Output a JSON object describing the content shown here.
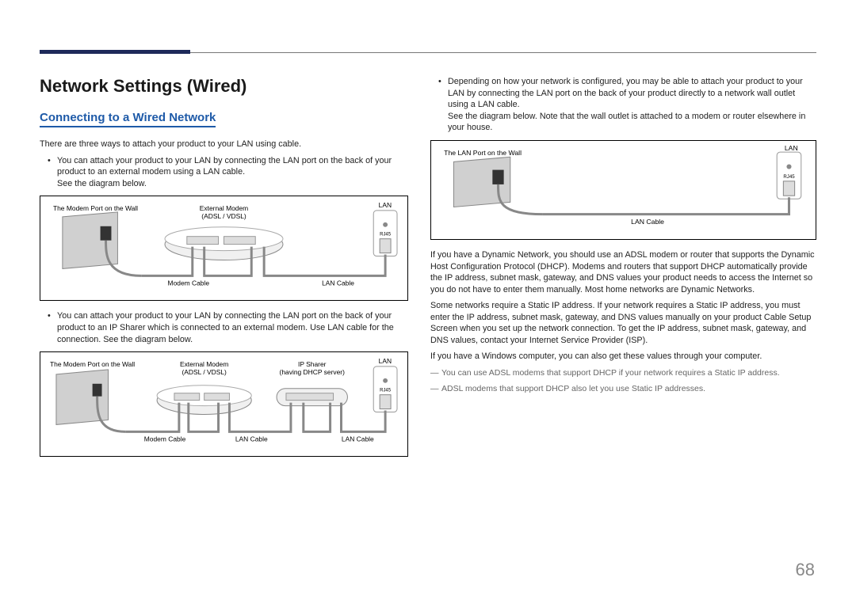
{
  "page_number": "68",
  "title": "Network Settings (Wired)",
  "subtitle": "Connecting to a Wired Network",
  "intro": "There are three ways to attach your product to your LAN using cable.",
  "left_bullet1": "You can attach your product to your LAN by connecting the LAN port on the back of your product to an external modem using a LAN cable.",
  "see_below": "See the diagram below.",
  "left_bullet2": "You can attach your product to your LAN by connecting the LAN port on the back of your product to an IP Sharer which is connected to an external modem. Use LAN cable for the connection. See the diagram below.",
  "right_bullet": "Depending on how your network is configured, you may be able to attach your product to your LAN by connecting the LAN port on the back of your product directly to a network wall outlet using a LAN cable.",
  "right_see": "See the diagram below. Note that the wall outlet is attached to a modem or router elsewhere in your house.",
  "right_p1": "If you have a Dynamic Network, you should use an ADSL modem or router that supports the Dynamic Host Configuration Protocol (DHCP). Modems and routers that support DHCP automatically provide the IP address, subnet mask, gateway, and DNS values your product needs to access the Internet so you do not have to enter them manually. Most home networks are Dynamic Networks.",
  "right_p2": "Some networks require a Static IP address. If your network requires a Static IP address, you must enter the IP address, subnet mask, gateway, and DNS values manually on your product Cable Setup Screen when you set up the network connection. To get the IP address, subnet mask, gateway, and DNS values, contact your Internet Service Provider (ISP).",
  "right_p3": "If you have a Windows computer, you can also get these values through your computer.",
  "note1": "You can use ADSL modems that support DHCP if your network requires a Static IP address.",
  "note2": "ADSL modems that support DHCP also let you use Static IP addresses.",
  "diag_labels": {
    "modem_port_wall": "The Modem Port on the Wall",
    "external_modem": "External Modem",
    "adsl_vdsl": "(ADSL / VDSL)",
    "ip_sharer": "IP Sharer",
    "dhcp_server": "(having DHCP server)",
    "lan": "LAN",
    "rj45": "RJ45",
    "modem_cable": "Modem Cable",
    "lan_cable": "LAN Cable",
    "lan_port_wall": "The LAN Port on the Wall"
  }
}
